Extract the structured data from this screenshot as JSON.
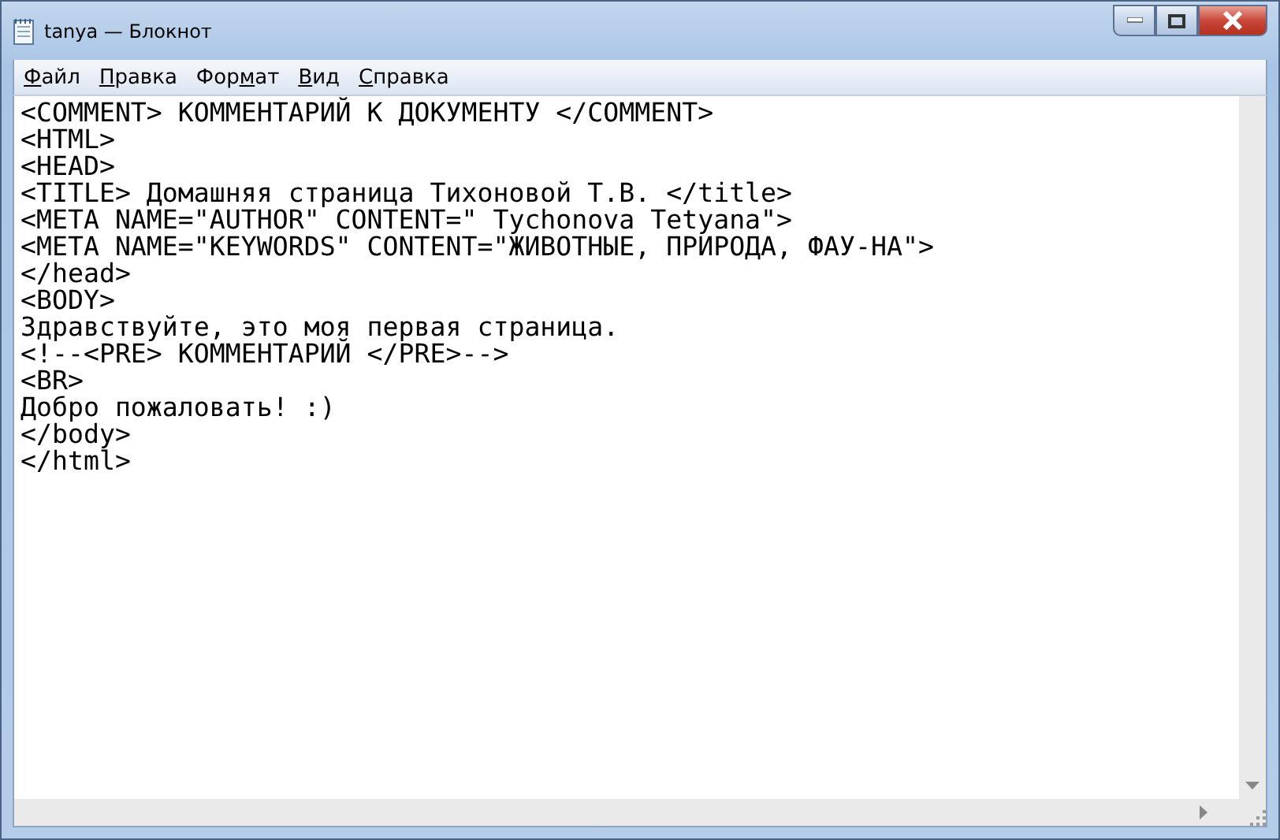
{
  "window": {
    "title": "tanya — Блокнот"
  },
  "menu": [
    {
      "key": "Ф",
      "after": "айл"
    },
    {
      "key": "П",
      "after": "равка"
    },
    {
      "before": "Фор",
      "key": "м",
      "after": "ат"
    },
    {
      "key": "В",
      "after": "ид"
    },
    {
      "key": "С",
      "after": "правка"
    }
  ],
  "lines": [
    "<COMMENT> КОММЕНТАРИЙ К ДОКУМЕНТУ </COMMENT>",
    "<HTML>",
    "<HEAD>",
    "<TITLE> Домашняя страница Тихоновой Т.В. </title>",
    "<META NAME=\"AUTHOR\" CONTENT=\" Tychonova Tetyana\">",
    "<META NAME=\"KEYWORDS\" CONTENT=\"ЖИВОТНЫЕ, ПРИРОДА, ФАУ-НА\">",
    "</head>",
    "<BODY>",
    "Здравствуйте, это моя первая страница.",
    "<!--<PRE> КОММЕНТАРИЙ </PRE>-->",
    "<BR>",
    "Добро пожаловать! :)",
    "</body>",
    "</html>"
  ]
}
